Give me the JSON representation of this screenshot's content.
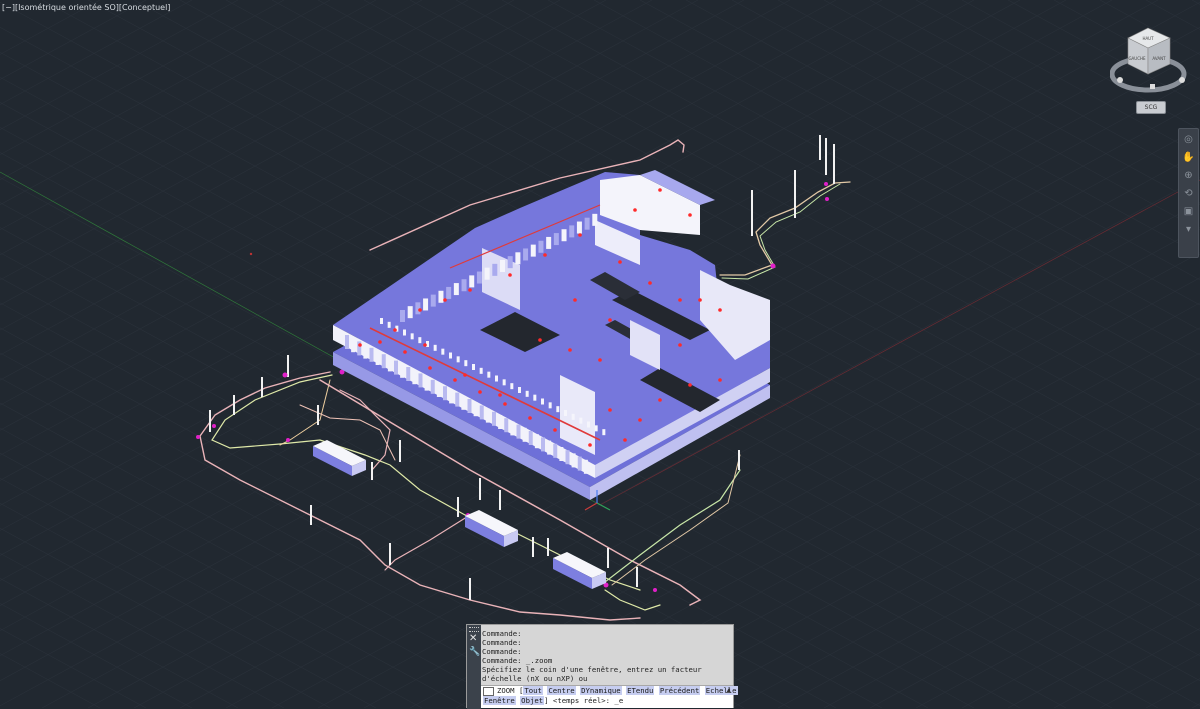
{
  "viewport": {
    "label": "[−][Isométrique orientée SO][Conceptuel]",
    "background": "#212830"
  },
  "viewcube": {
    "faces": [
      "HAUT",
      "GAUCHE",
      "AVANT"
    ],
    "ucs_button": "SCG"
  },
  "navbar": {
    "icons": [
      "steering-wheel-icon",
      "pan-icon",
      "zoom-icon",
      "orbit-icon",
      "showmotion-icon"
    ]
  },
  "command_window": {
    "history": [
      "Commande:",
      "Commande:",
      "Commande:",
      "Commande:  _.zoom",
      "Spécifiez le coin d'une fenêtre, entrez un facteur",
      "d'échelle (nX ou nXP) ou"
    ],
    "prompt": {
      "command": "ZOOM [",
      "options_line1": [
        {
          "text": "Tout",
          "hotkey": "T"
        },
        {
          "text": "Centre",
          "hotkey": "C"
        },
        {
          "text": "DYnamique",
          "hotkey": "DY"
        },
        {
          "text": "ETendu",
          "hotkey": "ET"
        },
        {
          "text": "Précédent",
          "hotkey": "P"
        },
        {
          "text": "Echelle",
          "hotkey": "E"
        }
      ],
      "options_line2": [
        {
          "text": "Fenêtre",
          "hotkey": "F"
        },
        {
          "text": "Objet",
          "hotkey": "O"
        }
      ],
      "suffix": "] <temps réel>: _e"
    }
  }
}
